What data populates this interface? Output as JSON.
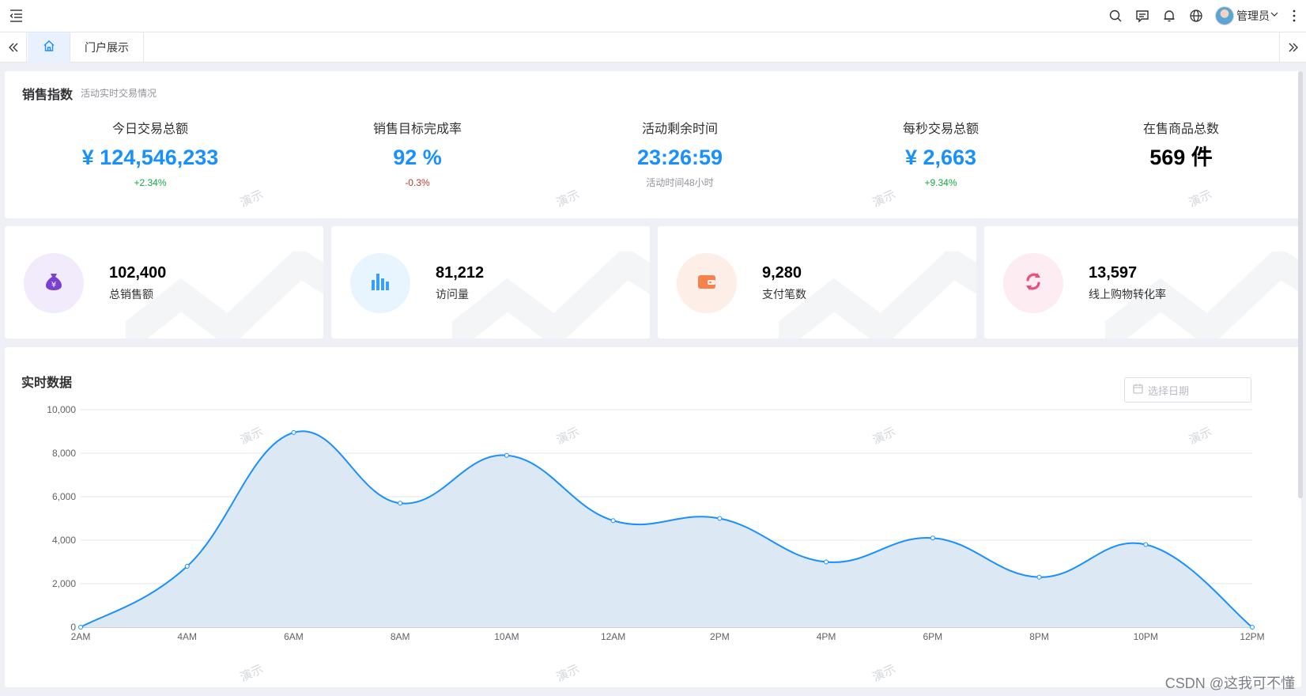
{
  "header": {
    "user_name": "管理员",
    "icons": [
      "menu-fold-icon",
      "search-icon",
      "message-icon",
      "bell-icon",
      "globe-icon",
      "chevron-down-icon",
      "more-vertical-icon"
    ]
  },
  "tabs": {
    "home_icon": "home-icon",
    "items": [
      "门户展示"
    ]
  },
  "sales": {
    "title": "销售指数",
    "subtitle": "活动实时交易情况",
    "metrics": [
      {
        "label": "今日交易总额",
        "value": "¥ 124,546,233",
        "sub": "+2.34%",
        "trend": "up"
      },
      {
        "label": "销售目标完成率",
        "value": "92 %",
        "sub": "-0.3%",
        "trend": "down"
      },
      {
        "label": "活动剩余时间",
        "value": "23:26:59",
        "sub": "活动时间48小时",
        "trend": "neutral"
      },
      {
        "label": "每秒交易总额",
        "value": "¥ 2,663",
        "sub": "+9.34%",
        "trend": "up"
      },
      {
        "label": "在售商品总数",
        "value": "569 件",
        "sub": "",
        "trend": "neutral"
      }
    ]
  },
  "stats": [
    {
      "value": "102,400",
      "label": "总销售额",
      "icon": "money-bag-icon",
      "color": "#7b3fd1",
      "bg": "#f2ebfb"
    },
    {
      "value": "81,212",
      "label": "访问量",
      "icon": "bar-chart-icon",
      "color": "#3aa0f5",
      "bg": "#e9f5fe"
    },
    {
      "value": "9,280",
      "label": "支付笔数",
      "icon": "wallet-icon",
      "color": "#f5824e",
      "bg": "#fdeee7"
    },
    {
      "value": "13,597",
      "label": "线上购物转化率",
      "icon": "refresh-icon",
      "color": "#ee4e7c",
      "bg": "#fdecf1"
    }
  ],
  "realtime": {
    "title": "实时数据",
    "date_placeholder": "选择日期"
  },
  "chart_data": {
    "type": "area",
    "title": "实时数据",
    "x": [
      "2AM",
      "4AM",
      "6AM",
      "8AM",
      "10AM",
      "12AM",
      "2PM",
      "4PM",
      "6PM",
      "8PM",
      "10PM",
      "12PM"
    ],
    "series": [
      {
        "values": [
          0,
          2800,
          8950,
          5700,
          7900,
          4900,
          5000,
          3000,
          4100,
          2300,
          3800,
          0
        ]
      }
    ],
    "yticks": [
      "0",
      "2,000",
      "4,000",
      "6,000",
      "8,000",
      "10,000"
    ],
    "ylim": [
      0,
      10000
    ],
    "grid": true,
    "line_color": "#1890ff",
    "fill_color": "#dde8f5"
  },
  "watermark_text": "演示",
  "credit": "CSDN @这我可不懂"
}
